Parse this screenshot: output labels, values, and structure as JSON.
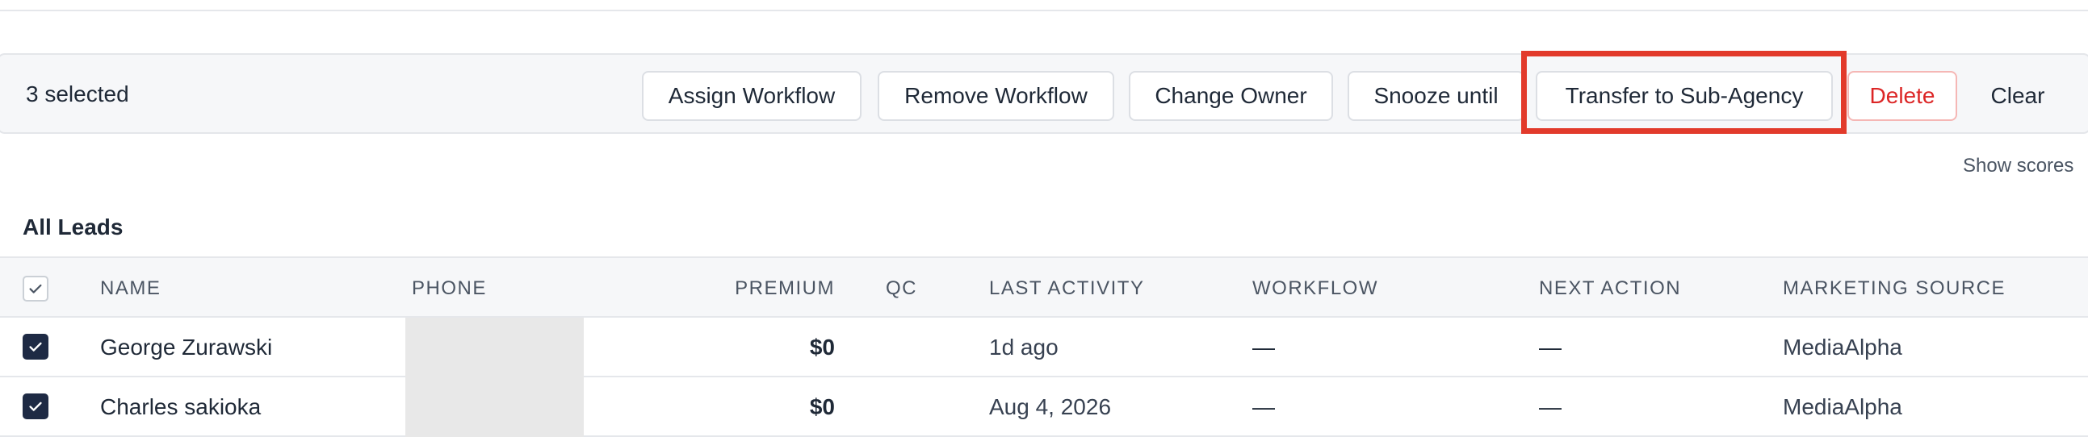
{
  "bulk_bar": {
    "selected_text": "3 selected",
    "actions": {
      "assign_workflow": "Assign Workflow",
      "remove_workflow": "Remove Workflow",
      "change_owner": "Change Owner",
      "snooze_until": "Snooze until",
      "transfer_sub_agency": "Transfer to Sub-Agency",
      "delete": "Delete",
      "clear": "Clear"
    }
  },
  "show_scores_label": "Show scores",
  "section_title": "All Leads",
  "table": {
    "columns": {
      "name": "Name",
      "phone": "Phone",
      "premium": "Premium",
      "qc": "QC",
      "last_activity": "Last Activity",
      "workflow": "Workflow",
      "next_action": "Next Action",
      "marketing_source": "Marketing Source"
    },
    "rows": [
      {
        "checked": true,
        "name": "George Zurawski",
        "phone": "",
        "premium": "$0",
        "qc": "",
        "last_activity": "1d ago",
        "workflow": "—",
        "next_action": "—",
        "marketing_source": "MediaAlpha"
      },
      {
        "checked": true,
        "name": "Charles sakioka",
        "phone": "",
        "premium": "$0",
        "qc": "",
        "last_activity": "Aug 4, 2026",
        "workflow": "—",
        "next_action": "—",
        "marketing_source": "MediaAlpha"
      }
    ]
  },
  "colors": {
    "accent_dark": "#1e2a44",
    "danger": "#dc2626",
    "highlight": "#e23a2b"
  }
}
